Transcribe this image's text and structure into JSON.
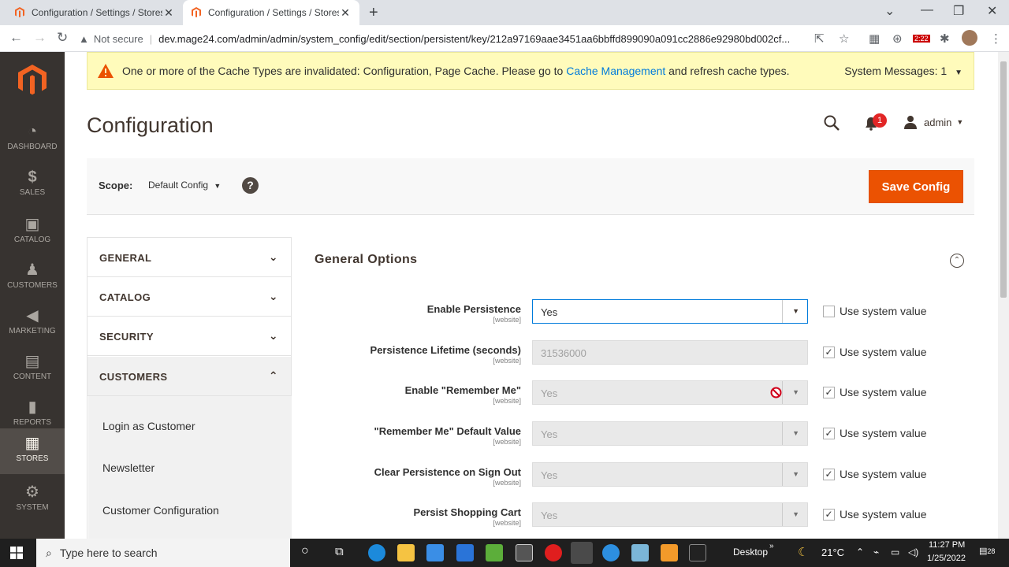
{
  "browser": {
    "tabs": [
      {
        "title": "Configuration / Settings / Stores",
        "active": false
      },
      {
        "title": "Configuration / Settings / Stores",
        "active": true
      }
    ],
    "security_label": "Not secure",
    "url": "dev.mage24.com/admin/admin/system_config/edit/section/persistent/key/212a97169aae3451aa6bbffd899090a091cc2886e92980bd002cf...",
    "ext_badge": "2:22"
  },
  "sidebar": {
    "items": [
      {
        "label": "DASHBOARD",
        "icon": "dashboard-icon",
        "glyph": "◔"
      },
      {
        "label": "SALES",
        "icon": "dollar-icon",
        "glyph": "$"
      },
      {
        "label": "CATALOG",
        "icon": "cube-icon",
        "glyph": "▣"
      },
      {
        "label": "CUSTOMERS",
        "icon": "person-icon",
        "glyph": "♟"
      },
      {
        "label": "MARKETING",
        "icon": "megaphone-icon",
        "glyph": "◀"
      },
      {
        "label": "CONTENT",
        "icon": "layout-icon",
        "glyph": "▤"
      },
      {
        "label": "REPORTS",
        "icon": "bar-chart-icon",
        "glyph": "▮"
      },
      {
        "label": "STORES",
        "icon": "store-icon",
        "glyph": "▦"
      },
      {
        "label": "SYSTEM",
        "icon": "gear-icon",
        "glyph": "⚙"
      }
    ]
  },
  "message": {
    "text_before": "One or more of the Cache Types are invalidated: Configuration, Page Cache. Please go to",
    "link": "Cache Management",
    "text_after": "and refresh cache types.",
    "system_messages": "System Messages: 1"
  },
  "header": {
    "title": "Configuration",
    "notification_count": "1",
    "user": "admin"
  },
  "scope": {
    "label": "Scope:",
    "value": "Default Config",
    "help": "?",
    "save_label": "Save Config"
  },
  "nav": {
    "sections": [
      "GENERAL",
      "CATALOG",
      "SECURITY",
      "CUSTOMERS"
    ],
    "sub_items": [
      "Login as Customer",
      "Newsletter",
      "Customer Configuration"
    ]
  },
  "group": {
    "title": "General Options"
  },
  "fields": [
    {
      "label": "Enable Persistence",
      "scope": "[website]",
      "value": "Yes",
      "type": "select",
      "disabled": false,
      "use_system": false
    },
    {
      "label": "Persistence Lifetime (seconds)",
      "scope": "[website]",
      "value": "31536000",
      "type": "text",
      "disabled": true,
      "use_system": true
    },
    {
      "label": "Enable \"Remember Me\"",
      "scope": "[website]",
      "value": "Yes",
      "type": "select",
      "disabled": true,
      "use_system": true
    },
    {
      "label": "\"Remember Me\" Default Value",
      "scope": "[website]",
      "value": "Yes",
      "type": "select",
      "disabled": true,
      "use_system": true
    },
    {
      "label": "Clear Persistence on Sign Out",
      "scope": "[website]",
      "value": "Yes",
      "type": "select",
      "disabled": true,
      "use_system": true
    },
    {
      "label": "Persist Shopping Cart",
      "scope": "[website]",
      "value": "Yes",
      "type": "select",
      "disabled": true,
      "use_system": true
    }
  ],
  "use_system_label": "Use system value",
  "taskbar": {
    "search_placeholder": "Type here to search",
    "desktop_label": "Desktop",
    "weather": "21°C",
    "time": "11:27 PM",
    "date": "1/25/2022",
    "notifications": "28"
  }
}
